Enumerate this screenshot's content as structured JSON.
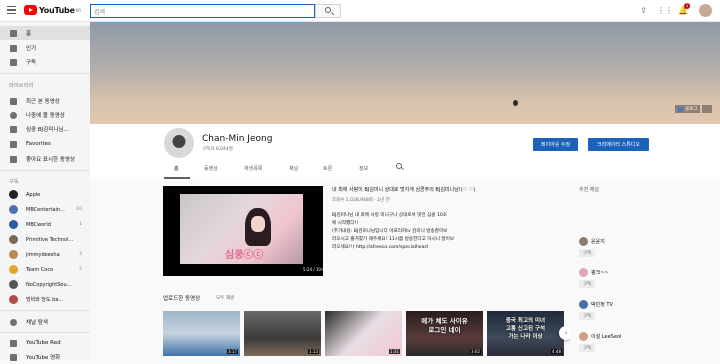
{
  "topbar": {
    "logo_text": "YouTube",
    "logo_region": "KR",
    "search_placeholder": "검색",
    "notif_count": "1"
  },
  "sidebar": {
    "main_items": [
      {
        "label": "홈",
        "icon": "home-icon"
      },
      {
        "label": "인기",
        "icon": "fire-icon"
      },
      {
        "label": "구독",
        "icon": "subscriptions-icon"
      }
    ],
    "library_title": "라이브러리",
    "library_items": [
      {
        "label": "최근 본 동영상",
        "icon": "history-icon"
      },
      {
        "label": "나중에 볼 동영상",
        "icon": "clock-icon"
      },
      {
        "label": "심쿵 BJ김미니님...",
        "icon": "playlist-icon"
      },
      {
        "label": "Favorites",
        "icon": "playlist-icon"
      },
      {
        "label": "좋아요 표시한 동영상",
        "icon": "thumbs-up-icon"
      }
    ],
    "subs_title": "구독",
    "subs": [
      {
        "name": "Apple",
        "count": "",
        "color": "#222222"
      },
      {
        "name": "MBCentertain...",
        "count": "10",
        "color": "#4e6fb0"
      },
      {
        "name": "MBCworld",
        "count": "1",
        "color": "#2f5a9e"
      },
      {
        "name": "Primitive Technol...",
        "count": "",
        "color": "#7a6a52"
      },
      {
        "name": "jimmydeesha",
        "count": "3",
        "color": "#b8875c"
      },
      {
        "name": "Team Coco",
        "count": "2",
        "color": "#e0a52a"
      },
      {
        "name": "NoCopyrightSou...",
        "count": "",
        "color": "#555555"
      },
      {
        "name": "빙비와 당도 ba...",
        "count": "",
        "color": "#b34b4b"
      }
    ],
    "browse_channels": "채널 탐색",
    "more_items": [
      {
        "label": "YouTube Red",
        "icon": "yt-red-icon"
      },
      {
        "label": "YouTube 영화",
        "icon": "film-icon"
      }
    ]
  },
  "banner": {
    "links": [
      "블로그"
    ]
  },
  "channel": {
    "name": "Chan-Min Jeong",
    "subscribers": "구독자 6,044명",
    "customize_label": "레이아웃 수정",
    "studio_label": "크리에이터 스튜디오"
  },
  "tabs": [
    "홈",
    "동영상",
    "재생목록",
    "채널",
    "토론",
    "정보"
  ],
  "featured": {
    "title": "내 최애 사랑이 BJ김미니 상대로 멋지게 심쿵주의 BJ김미니님!(♡ ♡)",
    "meta": "조회수 1,028,948회 · 1년 전",
    "caption": "심쿵ⓒⓒ",
    "time": "5:24 / 10:08",
    "desc": [
      "BJ김미니님 내 최애 사랑 미니구나 상대로서 멋진 심쿵 10초",
      "에 시작했다!!",
      "(추가내용: BJ김미니님입니다 아프리카tv 김미니 방송잘이보",
      "러오시고 즐겨찾기 해주세요! 11시쯤 방송한다고 하시니 많이보",
      "러오세요!!) http://afreeca.com/specialheart"
    ]
  },
  "uploads": {
    "title": "업로드한 동영상",
    "play_all": "모두 재생",
    "videos": [
      {
        "duration": "3:17",
        "overlay": "",
        "bg": "linear-gradient(180deg,#9fb6c9 0%,#c7d3de 50%,#3f74a8 100%)"
      },
      {
        "duration": "1:13",
        "overlay": "",
        "bg": "linear-gradient(180deg,#6a6a6a 0%,#3a3a3a 60%,#7c6a5a 100%)"
      },
      {
        "duration": "1:31",
        "overlay": "",
        "bg": "linear-gradient(135deg,#2a2a2a 0%,#e8dde4 50%,#f3c7d2 100%)"
      },
      {
        "duration": "3:02",
        "overlay": "메가 체도 사이유\n로그인 네이",
        "bg": "linear-gradient(180deg,#2a1d1d 0%,#5a3a3a 60%,#2a2a2a 100%)"
      },
      {
        "duration": "4:48",
        "overlay": "중국 최고의 미녀\n고통 신고된 구석\n가는 나라 이상",
        "bg": "linear-gradient(180deg,#1f2a3a 0%,#3f4a5a 60%,#2a2a35 100%)"
      }
    ]
  },
  "related": {
    "title": "추천 채널",
    "channels": [
      {
        "name": "윤윤지",
        "button": "구독",
        "color": "#8c7b6c"
      },
      {
        "name": "핑크~~",
        "button": "구독",
        "color": "#e0a5b8"
      },
      {
        "name": "박민정 TV",
        "button": "구독",
        "color": "#4a6ea8"
      },
      {
        "name": "이설 LeeSeol",
        "button": "구독",
        "color": "#c9a08a"
      }
    ]
  },
  "colors": {
    "brand_red": "#ff0000",
    "accent_blue": "#1c62b9"
  }
}
